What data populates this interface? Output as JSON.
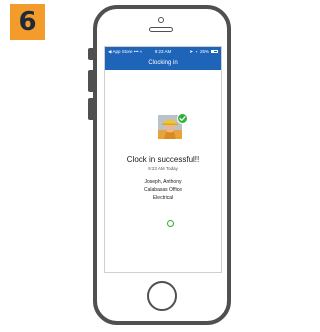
{
  "step": {
    "number": "6"
  },
  "status_bar": {
    "left": "App Store",
    "time": "9:23 AM",
    "battery": "25%"
  },
  "nav": {
    "title": "Clocking in"
  },
  "main": {
    "title": "Clock in successful!!",
    "time": "9:23 AM Today",
    "employee_name": "Joseph, Anthony",
    "office": "Calabasas Office",
    "department": "Electrical"
  },
  "colors": {
    "accent_blue": "#1e64b8",
    "badge_orange": "#f39c2c",
    "success_green": "#2eb135",
    "device_gray": "#505050"
  }
}
